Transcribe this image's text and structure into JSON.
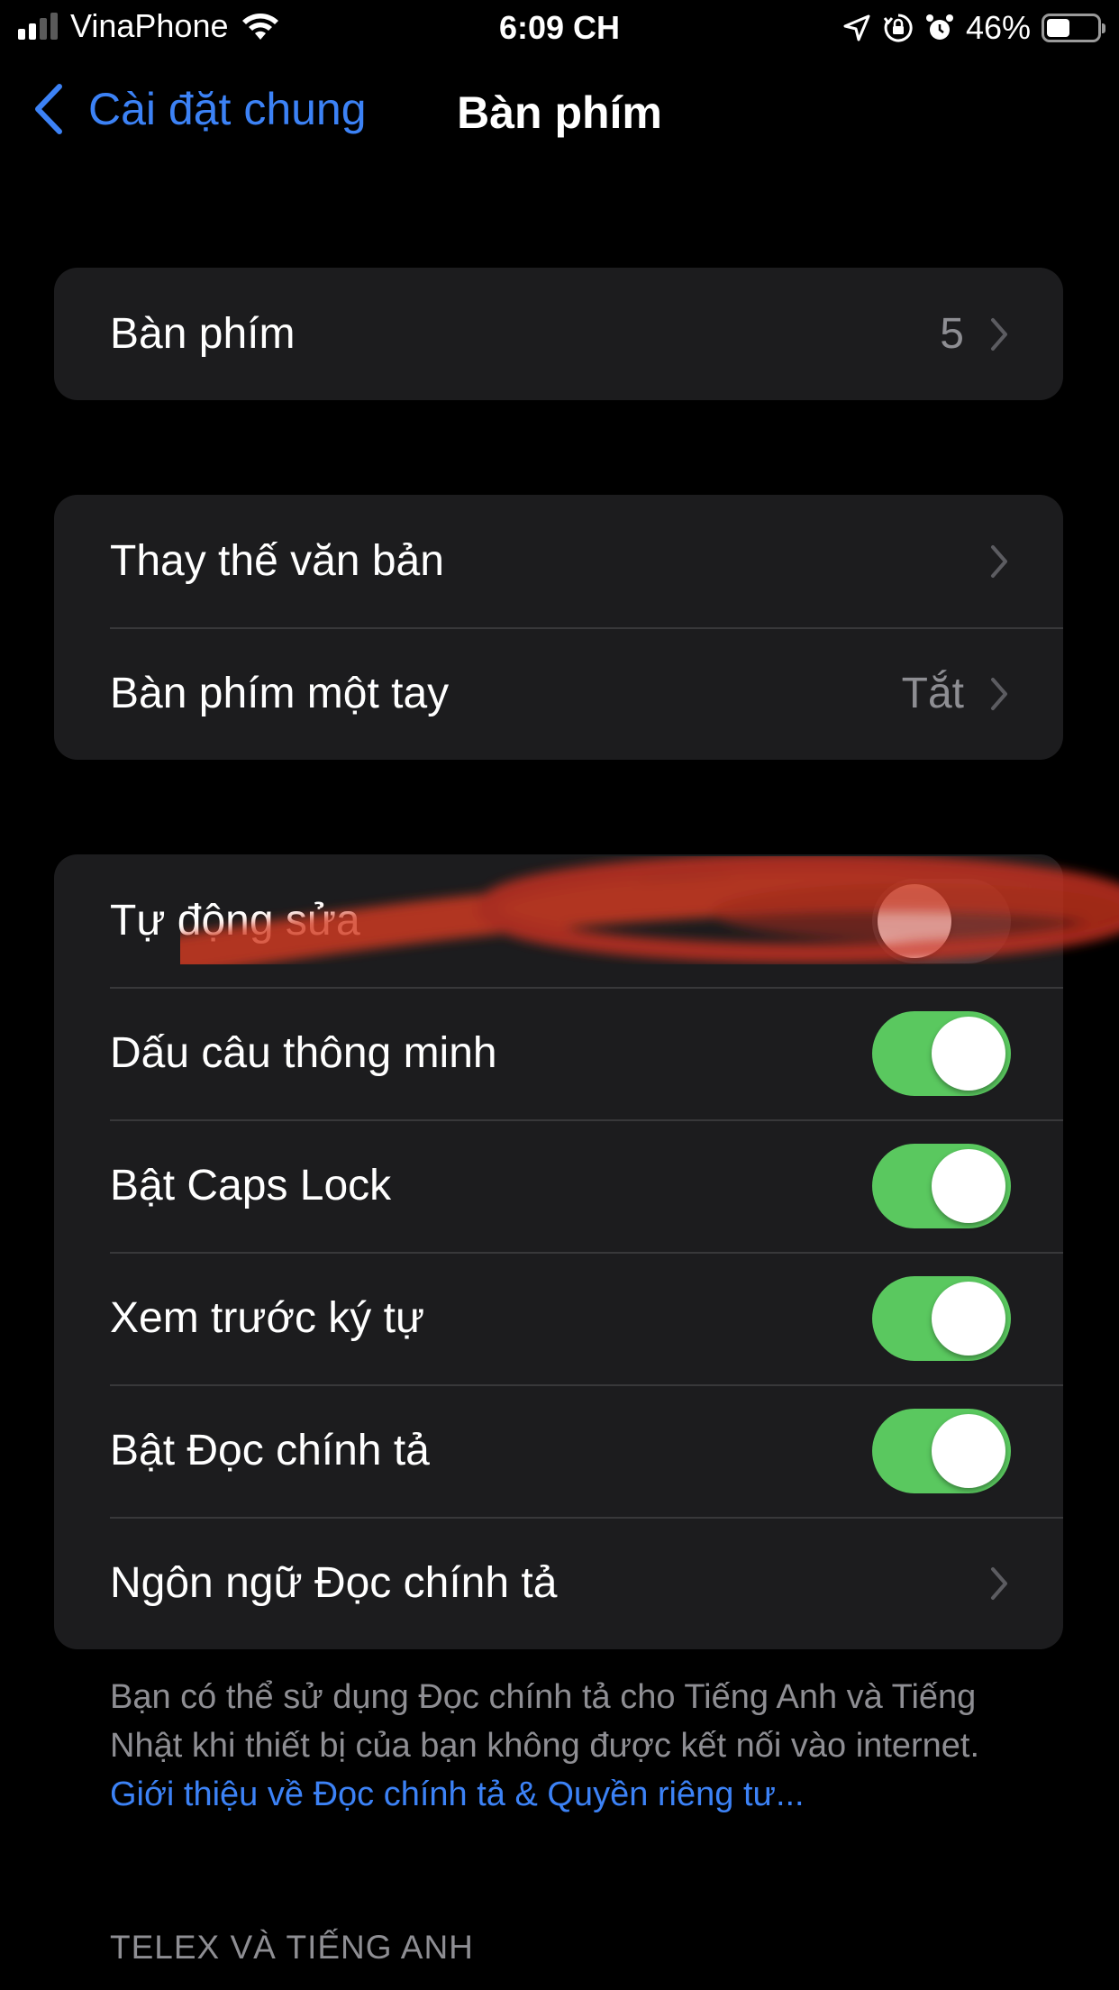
{
  "status_bar": {
    "carrier": "VinaPhone",
    "time": "6:09 CH",
    "battery_percent": "46%",
    "battery_level": 0.46,
    "signal_bars": 2,
    "icons": [
      "signal-icon",
      "wifi-icon",
      "location-icon",
      "orientation-lock-icon",
      "alarm-icon",
      "battery-icon"
    ]
  },
  "nav": {
    "back_label": "Cài đặt chung",
    "title": "Bàn phím"
  },
  "groups": [
    {
      "rows": [
        {
          "label": "Bàn phím",
          "value": "5",
          "type": "link"
        }
      ]
    },
    {
      "rows": [
        {
          "label": "Thay thế văn bản",
          "value": "",
          "type": "link"
        },
        {
          "label": "Bàn phím một tay",
          "value": "Tắt",
          "type": "link"
        }
      ]
    },
    {
      "rows": [
        {
          "label": "Tự động sửa",
          "type": "toggle",
          "on": false
        },
        {
          "label": "Dấu câu thông minh",
          "type": "toggle",
          "on": true
        },
        {
          "label": "Bật Caps Lock",
          "type": "toggle",
          "on": true
        },
        {
          "label": "Xem trước ký tự",
          "type": "toggle",
          "on": true
        },
        {
          "label": "Bật Đọc chính tả",
          "type": "toggle",
          "on": true
        },
        {
          "label": "Ngôn ngữ Đọc chính tả",
          "type": "link"
        }
      ]
    }
  ],
  "footnote": {
    "text": "Bạn có thể sử dụng Đọc chính tả cho Tiếng Anh và Tiếng Nhật khi thiết bị của bạn không được kết nối vào internet. ",
    "link": "Giới thiệu về Đọc chính tả & Quyền riêng tư..."
  },
  "section_header": "TELEX VÀ TIẾNG ANH",
  "colors": {
    "background": "#000000",
    "cell": "#1c1c1e",
    "accent": "#3c82f6",
    "toggle_on": "#5ac85f",
    "toggle_off": "#39393d",
    "secondary_text": "#8e8e93",
    "scribble": "#d23a22"
  }
}
